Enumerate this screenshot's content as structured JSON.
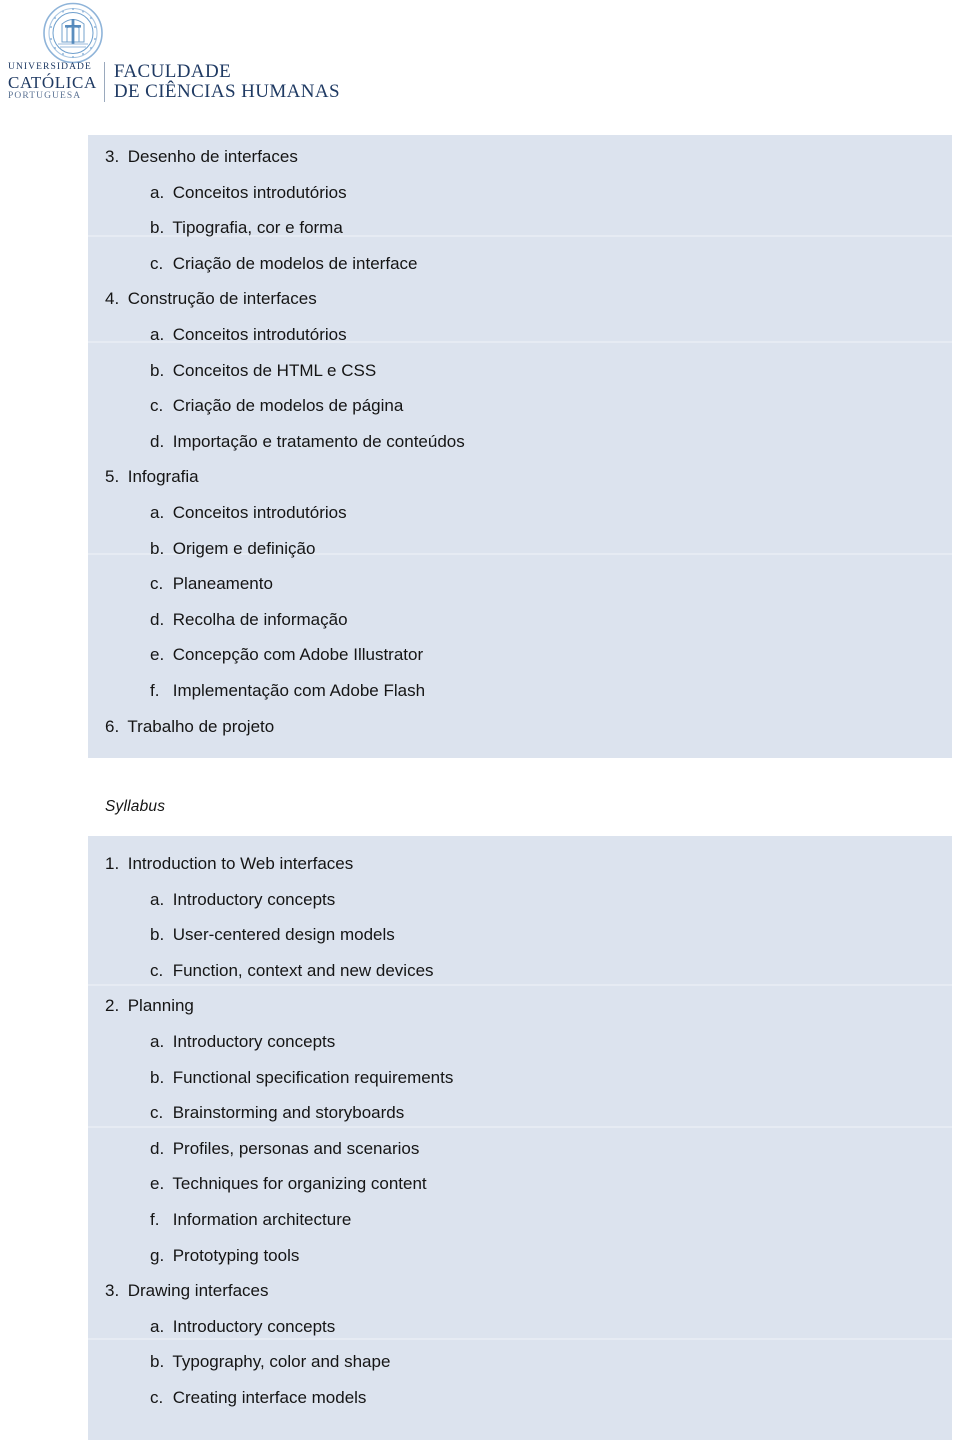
{
  "letterhead": {
    "seal_icon": "university-seal-icon",
    "university_line1": "UNIVERSIDADE",
    "university_line2": "CATÓLICA",
    "university_line3": "PORTUGUESA",
    "faculty_line1": "FACULDADE",
    "faculty_line2": "DE CIÊNCIAS HUMANAS",
    "brand_color": "#1f3a63"
  },
  "theme": {
    "band_color": "#dce3ee",
    "page_color": "#ffffff",
    "text_color": "#151515"
  },
  "syllabus_caption": "Syllabus",
  "programa_pt": [
    {
      "level": 1,
      "marker": "3.",
      "text": "Desenho de interfaces"
    },
    {
      "level": 2,
      "marker": "a.",
      "text": "Conceitos introdutórios"
    },
    {
      "level": 2,
      "marker": "b.",
      "text": "Tipografia, cor e forma"
    },
    {
      "level": 2,
      "marker": "c.",
      "text": "Criação de modelos de interface"
    },
    {
      "level": 1,
      "marker": "4.",
      "text": "Construção de interfaces"
    },
    {
      "level": 2,
      "marker": "a.",
      "text": "Conceitos introdutórios"
    },
    {
      "level": 2,
      "marker": "b.",
      "text": "Conceitos de HTML e CSS"
    },
    {
      "level": 2,
      "marker": "c.",
      "text": "Criação de modelos de página"
    },
    {
      "level": 2,
      "marker": "d.",
      "text": "Importação e tratamento de conteúdos"
    },
    {
      "level": 1,
      "marker": "5.",
      "text": "Infografia"
    },
    {
      "level": 2,
      "marker": "a.",
      "text": "Conceitos introdutórios"
    },
    {
      "level": 2,
      "marker": "b.",
      "text": "Origem e definição"
    },
    {
      "level": 2,
      "marker": "c.",
      "text": "Planeamento"
    },
    {
      "level": 2,
      "marker": "d.",
      "text": "Recolha de informação"
    },
    {
      "level": 2,
      "marker": "e.",
      "text": "Concepção com Adobe Illustrator"
    },
    {
      "level": 2,
      "marker": "f.",
      "text": "Implementação com Adobe Flash"
    },
    {
      "level": 1,
      "marker": "6.",
      "text": "Trabalho de projeto"
    }
  ],
  "syllabus_en": [
    {
      "level": 1,
      "marker": "1.",
      "text": "Introduction to Web interfaces"
    },
    {
      "level": 2,
      "marker": "a.",
      "text": "Introductory concepts"
    },
    {
      "level": 2,
      "marker": "b.",
      "text": "User-centered design models"
    },
    {
      "level": 2,
      "marker": "c.",
      "text": "Function, context and new devices"
    },
    {
      "level": 1,
      "marker": "2.",
      "text": "Planning"
    },
    {
      "level": 2,
      "marker": "a.",
      "text": "Introductory concepts"
    },
    {
      "level": 2,
      "marker": "b.",
      "text": "Functional specification requirements"
    },
    {
      "level": 2,
      "marker": "c.",
      "text": "Brainstorming and storyboards"
    },
    {
      "level": 2,
      "marker": "d.",
      "text": "Profiles, personas and scenarios"
    },
    {
      "level": 2,
      "marker": "e.",
      "text": "Techniques for organizing content"
    },
    {
      "level": 2,
      "marker": "f.",
      "text": "Information architecture"
    },
    {
      "level": 2,
      "marker": "g.",
      "text": "Prototyping tools"
    },
    {
      "level": 1,
      "marker": "3.",
      "text": "Drawing interfaces"
    },
    {
      "level": 2,
      "marker": "a.",
      "text": "Introductory concepts"
    },
    {
      "level": 2,
      "marker": "b.",
      "text": "Typography, color and shape"
    },
    {
      "level": 2,
      "marker": "c.",
      "text": "Creating interface models"
    }
  ]
}
